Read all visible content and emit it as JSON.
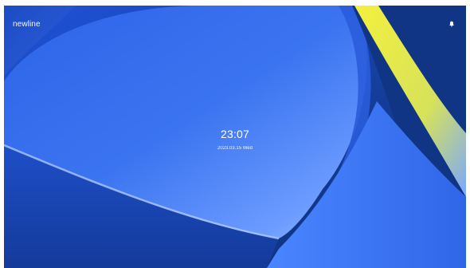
{
  "screen": {
    "brand": "newline",
    "time": "23:07",
    "date": "2023.03.15 Wed"
  },
  "icons": {
    "notification": "bell-icon"
  },
  "colors": {
    "deep_blue": "#0b2a6e",
    "mid_blue": "#2f63e6",
    "light_blue": "#6aa6ff",
    "accent_yellow": "#f0ec3c",
    "text": "#ffffff"
  }
}
